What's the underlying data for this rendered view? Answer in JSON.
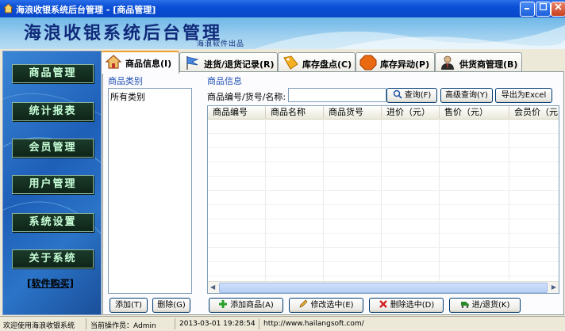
{
  "window": {
    "title": "海浪收银系统后台管理 - [商品管理]"
  },
  "banner": {
    "title": "海浪收银系统后台管理",
    "subtitle": "海浪软件出品"
  },
  "nav": {
    "items": [
      "商品管理",
      "统计报表",
      "会员管理",
      "用户管理",
      "系统设置",
      "关于系统"
    ],
    "buy_link": "[软件购买]"
  },
  "tabs": [
    {
      "label": "商品信息(I)",
      "icon": "house-icon"
    },
    {
      "label": "进货/退货记录(R)",
      "icon": "flag-icon"
    },
    {
      "label": "库存盘点(C)",
      "icon": "tag-icon"
    },
    {
      "label": "库存异动(P)",
      "icon": "stop-icon"
    },
    {
      "label": "供货商管理(B)",
      "icon": "person-icon"
    }
  ],
  "categories": {
    "title": "商品类别",
    "items": [
      "所有类别"
    ],
    "add_label": "添加(T)",
    "delete_label": "删除(G)"
  },
  "products": {
    "title": "商品信息",
    "search_label": "商品编号/货号/名称:",
    "search_value": "",
    "query_label": "查询(F)",
    "advanced_label": "高级查询(Y)",
    "export_label": "导出为Excel",
    "columns": [
      "商品编号",
      "商品名称",
      "商品货号",
      "进价（元）",
      "售价（元）",
      "会员价（元"
    ],
    "add_label": "添加商品(A)",
    "edit_label": "修改选中(E)",
    "delete_label": "删除选中(D)",
    "stock_label": "进/退货(K)"
  },
  "status": {
    "welcome": "欢迎使用海浪收银系统",
    "operator": "当前操作员：Admin",
    "datetime": "2013-03-01 19:28:54",
    "url": "http://www.hailangsoft.com/"
  }
}
